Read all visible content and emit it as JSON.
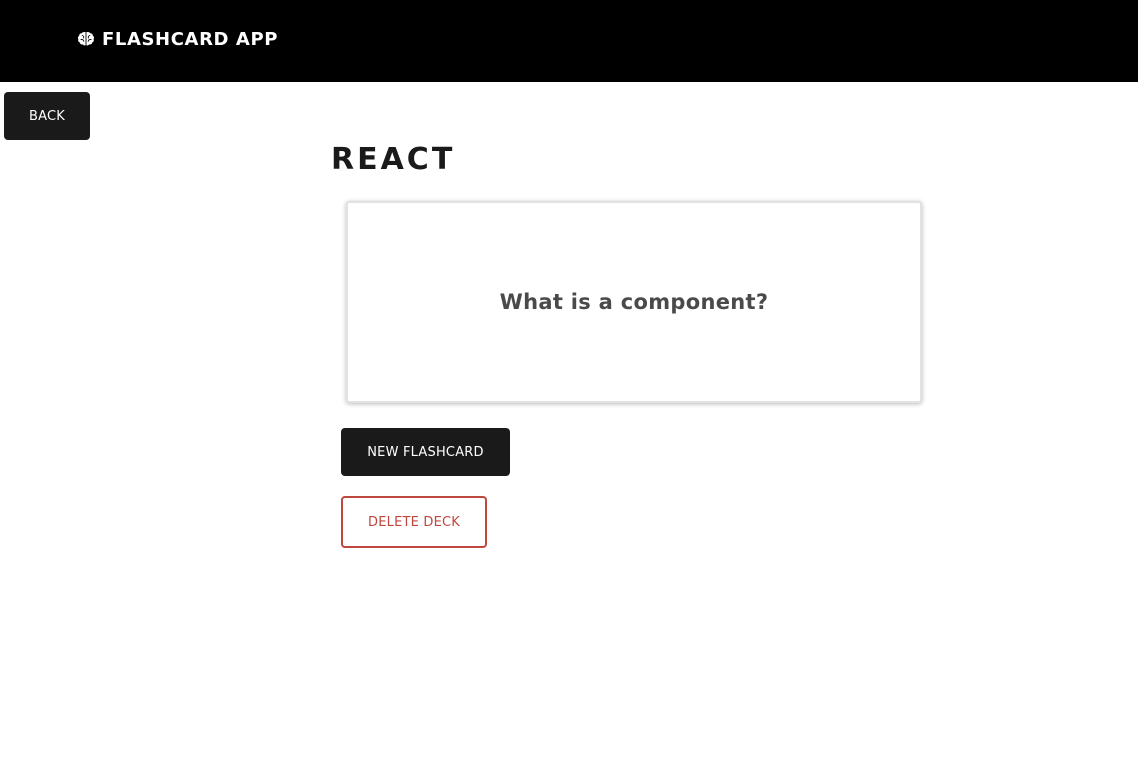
{
  "header": {
    "icon": "brain-icon",
    "title": "FLASHCARD APP"
  },
  "nav": {
    "back_label": "BACK"
  },
  "deck": {
    "title": "REACT",
    "card": {
      "text": "What is a component?"
    }
  },
  "actions": {
    "new_flashcard_label": "NEW FLASHCARD",
    "delete_deck_label": "DELETE DECK"
  },
  "colors": {
    "header_bg": "#000000",
    "primary_button": "#1a1a1a",
    "danger": "#c0473e",
    "card_text": "#4a4a4a"
  }
}
